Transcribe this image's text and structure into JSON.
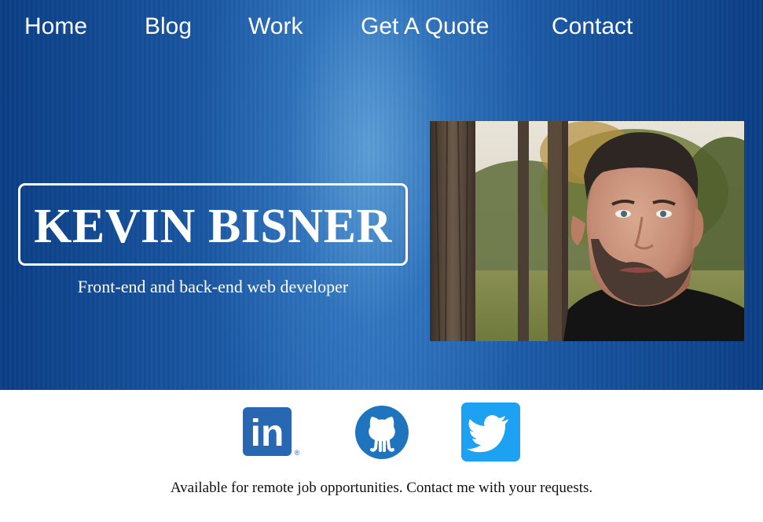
{
  "nav": {
    "items": [
      {
        "label": "Home"
      },
      {
        "label": "Blog"
      },
      {
        "label": "Work"
      },
      {
        "label": "Get A Quote"
      },
      {
        "label": "Contact"
      }
    ]
  },
  "hero": {
    "name": "KEVIN BISNER",
    "tagline": "Front-end and back-end web developer",
    "photo_alt": "Kevin Bisner portrait photo"
  },
  "social": {
    "linkedin": {
      "text": "in",
      "mark": "®",
      "color": "#2867B2",
      "icon": "linkedin-icon"
    },
    "github": {
      "color": "#1f74be",
      "icon": "github-octocat-icon"
    },
    "twitter": {
      "color": "#1DA1F2",
      "icon": "twitter-bird-icon"
    }
  },
  "footer": {
    "text": "Available for remote job opportunities. Contact me with your requests."
  }
}
